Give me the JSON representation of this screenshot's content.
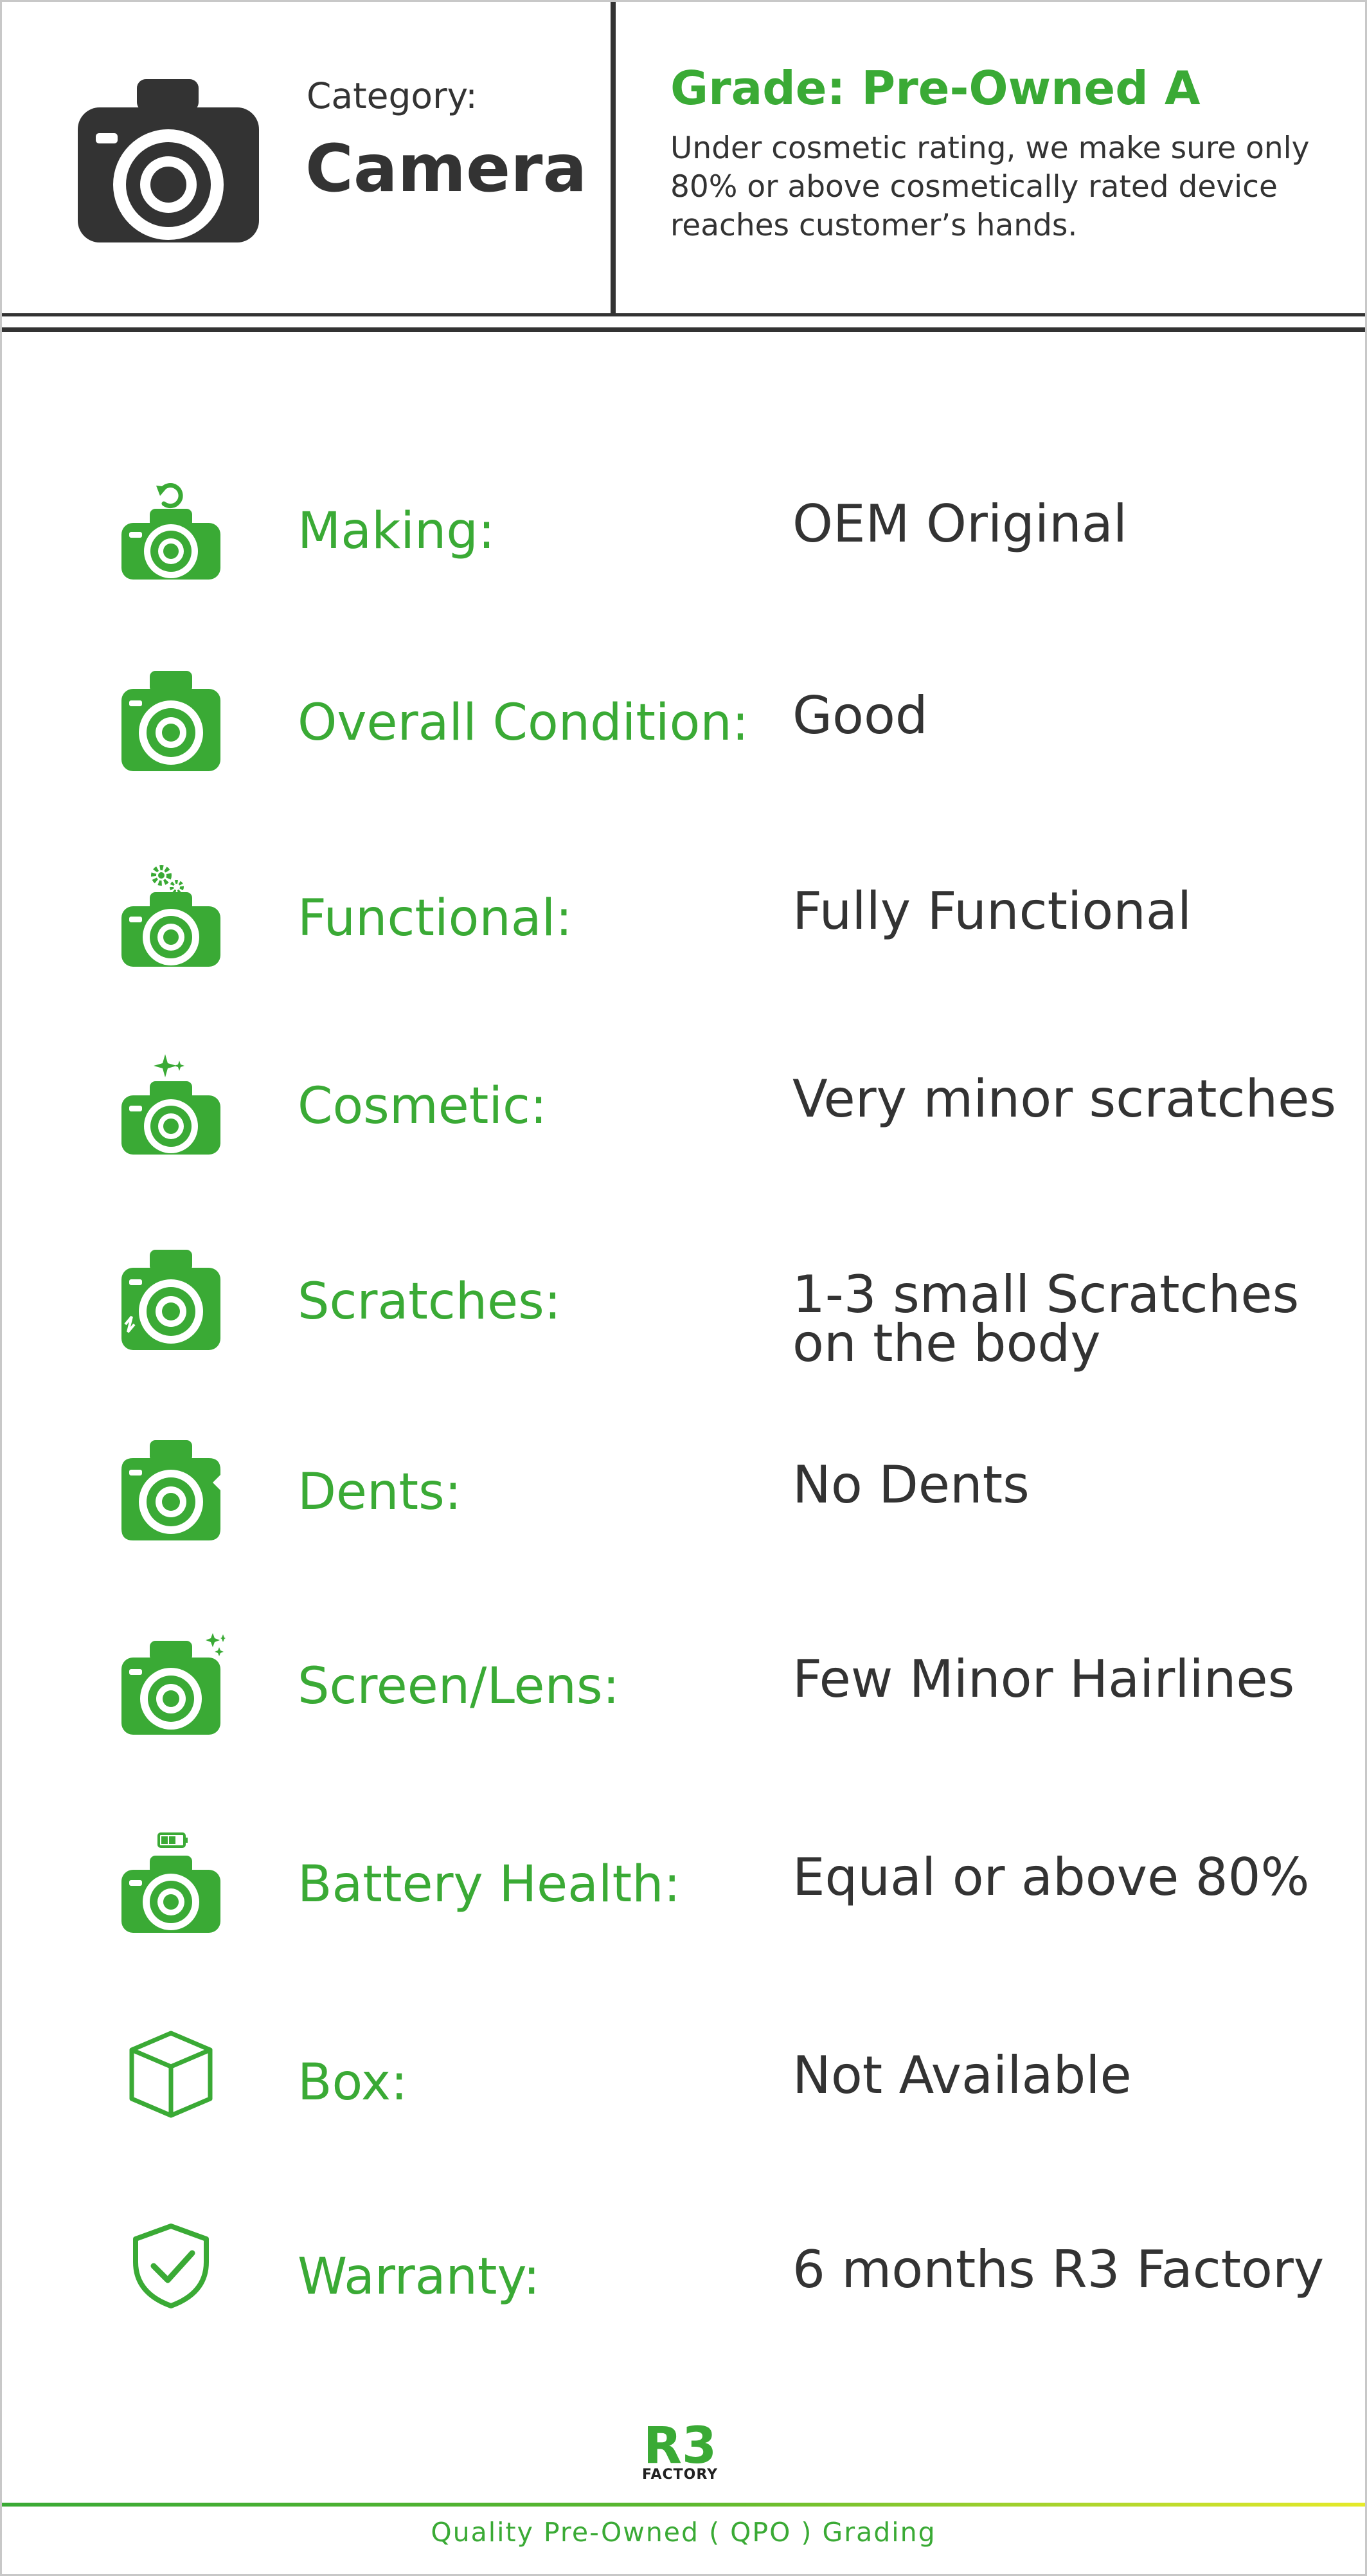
{
  "header": {
    "category_label": "Category:",
    "category_value": "Camera",
    "category_icon": "camera-icon",
    "grade_title": "Grade: Pre-Owned A",
    "grade_description": "Under cosmetic rating, we make sure only 80% or above cosmetically rated device reaches customer’s hands."
  },
  "colors": {
    "accent_green": "#3aaa35",
    "text_dark": "#333333",
    "footer_gradient_end": "#e6ea2a"
  },
  "rows": [
    {
      "icon": "camera-refresh-icon",
      "label": "Making:",
      "value": "OEM Original"
    },
    {
      "icon": "camera-icon",
      "label": "Overall Condition:",
      "value": "Good"
    },
    {
      "icon": "camera-gears-icon",
      "label": "Functional:",
      "value": "Fully Functional"
    },
    {
      "icon": "camera-sparkle-icon",
      "label": "Cosmetic:",
      "value": "Very minor scratches"
    },
    {
      "icon": "camera-scratch-icon",
      "label": "Scratches:",
      "value": "1-3 small Scratches on the body"
    },
    {
      "icon": "camera-dent-icon",
      "label": "Dents:",
      "value": "No Dents"
    },
    {
      "icon": "camera-lens-sparkle-icon",
      "label": "Screen/Lens:",
      "value": "Few Minor Hairlines"
    },
    {
      "icon": "camera-battery-icon",
      "label": "Battery Health:",
      "value": "Equal or above 80%"
    },
    {
      "icon": "box-icon",
      "label": "Box:",
      "value": "Not Available"
    },
    {
      "icon": "shield-check-icon",
      "label": "Warranty:",
      "value": "6 months R3 Factory"
    }
  ],
  "footer": {
    "logo_mark": "R3",
    "logo_text": "FACTORY",
    "caption": "Quality Pre-Owned ( QPO ) Grading"
  }
}
